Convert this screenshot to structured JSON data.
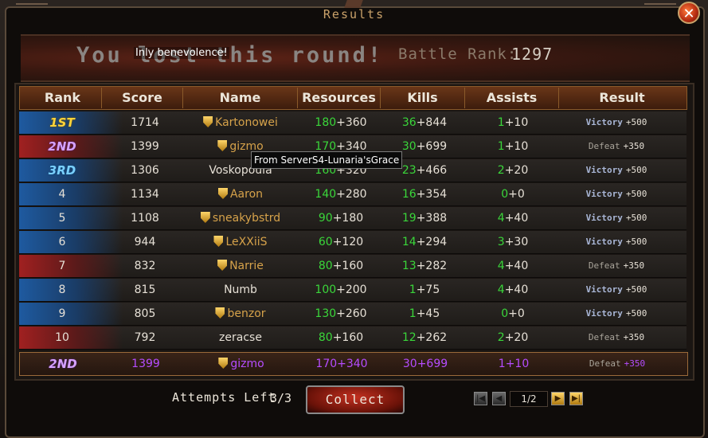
{
  "window": {
    "title": "Results",
    "close_icon": "✕"
  },
  "banner": {
    "headline": "You lost this round!",
    "tooltip_text": "Inly benevolence!",
    "battle_rank_label": "Battle Rank:",
    "battle_rank_value": "1297"
  },
  "table": {
    "columns": [
      "Rank",
      "Score",
      "Name",
      "Resources",
      "Kills",
      "Assists",
      "Result"
    ],
    "rows": [
      {
        "rank": "1ST",
        "rank_style": "1st",
        "band": "blue",
        "score": "1714",
        "name": "Kartonowei",
        "name_color": "gold",
        "shield": true,
        "res_base": "180",
        "res_bonus": "+360",
        "kills_base": "36",
        "kills_bonus": "+844",
        "assists_base": "1",
        "assists_bonus": "+10",
        "result": "Victory",
        "result_bonus": "+500"
      },
      {
        "rank": "2ND",
        "rank_style": "2nd",
        "band": "red",
        "score": "1399",
        "name": "gizmo",
        "name_color": "gold",
        "shield": true,
        "res_base": "170",
        "res_bonus": "+340",
        "kills_base": "30",
        "kills_bonus": "+699",
        "assists_base": "1",
        "assists_bonus": "+10",
        "result": "Defeat",
        "result_bonus": "+350"
      },
      {
        "rank": "3RD",
        "rank_style": "3rd",
        "band": "blue",
        "score": "1306",
        "name": "Voskopoula",
        "name_color": "white",
        "shield": false,
        "res_base": "160",
        "res_bonus": "+320",
        "kills_base": "23",
        "kills_bonus": "+466",
        "assists_base": "2",
        "assists_bonus": "+20",
        "result": "Victory",
        "result_bonus": "+500"
      },
      {
        "rank": "4",
        "rank_style": "plain",
        "band": "blue",
        "score": "1134",
        "name": "Aaron",
        "name_color": "gold",
        "shield": true,
        "res_base": "140",
        "res_bonus": "+280",
        "kills_base": "16",
        "kills_bonus": "+354",
        "assists_base": "0",
        "assists_bonus": "+0",
        "result": "Victory",
        "result_bonus": "+500"
      },
      {
        "rank": "5",
        "rank_style": "plain",
        "band": "blue",
        "score": "1108",
        "name": "sneakybstrd",
        "name_color": "gold",
        "shield": true,
        "res_base": "90",
        "res_bonus": "+180",
        "kills_base": "19",
        "kills_bonus": "+388",
        "assists_base": "4",
        "assists_bonus": "+40",
        "result": "Victory",
        "result_bonus": "+500"
      },
      {
        "rank": "6",
        "rank_style": "plain",
        "band": "blue",
        "score": "944",
        "name": "LeXXiiS",
        "name_color": "gold",
        "shield": true,
        "res_base": "60",
        "res_bonus": "+120",
        "kills_base": "14",
        "kills_bonus": "+294",
        "assists_base": "3",
        "assists_bonus": "+30",
        "result": "Victory",
        "result_bonus": "+500"
      },
      {
        "rank": "7",
        "rank_style": "plain",
        "band": "red",
        "score": "832",
        "name": "Narrie",
        "name_color": "gold",
        "shield": true,
        "res_base": "80",
        "res_bonus": "+160",
        "kills_base": "13",
        "kills_bonus": "+282",
        "assists_base": "4",
        "assists_bonus": "+40",
        "result": "Defeat",
        "result_bonus": "+350"
      },
      {
        "rank": "8",
        "rank_style": "plain",
        "band": "blue",
        "score": "815",
        "name": "Numb",
        "name_color": "white",
        "shield": false,
        "res_base": "100",
        "res_bonus": "+200",
        "kills_base": "1",
        "kills_bonus": "+75",
        "assists_base": "4",
        "assists_bonus": "+40",
        "result": "Victory",
        "result_bonus": "+500"
      },
      {
        "rank": "9",
        "rank_style": "plain",
        "band": "blue",
        "score": "805",
        "name": "benzor",
        "name_color": "gold",
        "shield": true,
        "res_base": "130",
        "res_bonus": "+260",
        "kills_base": "1",
        "kills_bonus": "+45",
        "assists_base": "0",
        "assists_bonus": "+0",
        "result": "Victory",
        "result_bonus": "+500"
      },
      {
        "rank": "10",
        "rank_style": "plain",
        "band": "red",
        "score": "792",
        "name": "zeracse",
        "name_color": "white",
        "shield": false,
        "res_base": "80",
        "res_bonus": "+160",
        "kills_base": "12",
        "kills_bonus": "+262",
        "assists_base": "2",
        "assists_bonus": "+20",
        "result": "Defeat",
        "result_bonus": "+350"
      }
    ],
    "self_row": {
      "rank": "2ND",
      "score": "1399",
      "name": "gizmo",
      "res_base": "170",
      "res_bonus": "+340",
      "kills_base": "30",
      "kills_bonus": "+699",
      "assists_base": "1",
      "assists_bonus": "+10",
      "result": "Defeat",
      "result_bonus": "+350"
    },
    "hover_tooltip": "From ServerS4-Lunaria'sGrace"
  },
  "footer": {
    "attempts_label": "Attempts Left",
    "attempts_value": "3/3",
    "collect_label": "Collect",
    "page_display": "1/2",
    "first_page_icon": "first-page-icon",
    "prev_page_icon": "prev-page-icon",
    "next_page_icon": "next-page-icon",
    "last_page_icon": "last-page-icon"
  },
  "colors": {
    "green_value": "#3ad63a",
    "gold_name": "#d6a24a",
    "self_purple": "#b54cff",
    "header_bg": "#6a3618"
  }
}
